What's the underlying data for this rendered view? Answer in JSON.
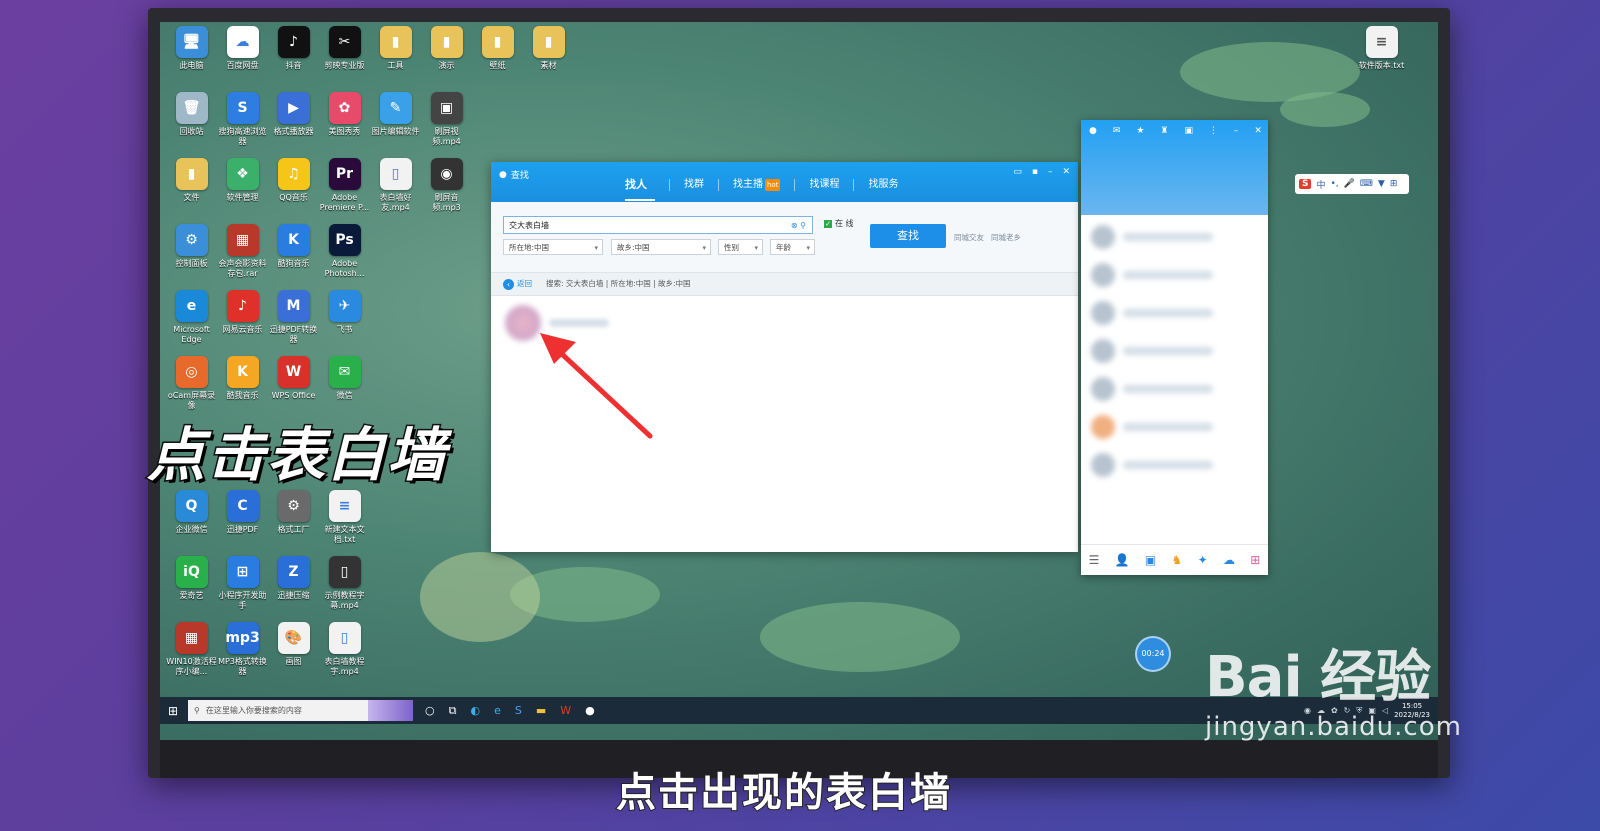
{
  "desktop": {
    "icons": [
      {
        "label": "此电脑",
        "color": "#3a8fd8",
        "glyph": "🖥"
      },
      {
        "label": "百度网盘",
        "color": "#ffffff",
        "glyph": "☁"
      },
      {
        "label": "抖音",
        "color": "#111111",
        "glyph": "♪"
      },
      {
        "label": "剪映专业版",
        "color": "#111111",
        "glyph": "✂"
      },
      {
        "label": "工具",
        "color": "#e8c35a",
        "glyph": "▮"
      },
      {
        "label": "演示",
        "color": "#e8c35a",
        "glyph": "▮"
      },
      {
        "label": "壁纸",
        "color": "#e8c35a",
        "glyph": "▮"
      },
      {
        "label": "素材",
        "color": "#e8c35a",
        "glyph": "▮"
      },
      {
        "label": "回收站",
        "color": "#9fb8c8",
        "glyph": "🗑"
      },
      {
        "label": "搜狗高速浏览器",
        "color": "#2e7de0",
        "glyph": "S"
      },
      {
        "label": "格式播放器",
        "color": "#3a6fd8",
        "glyph": "▶"
      },
      {
        "label": "美图秀秀",
        "color": "#e84a6a",
        "glyph": "✿"
      },
      {
        "label": "图片编辑软件",
        "color": "#3aa0e8",
        "glyph": "✎"
      },
      {
        "label": "刷屏视频.mp4",
        "color": "#444444",
        "glyph": "▣"
      },
      {
        "label": "",
        "color": "transparent",
        "glyph": ""
      },
      {
        "label": "",
        "color": "transparent",
        "glyph": ""
      },
      {
        "label": "文件",
        "color": "#e8c35a",
        "glyph": "▮"
      },
      {
        "label": "软件管理",
        "color": "#3ab06a",
        "glyph": "❖"
      },
      {
        "label": "QQ音乐",
        "color": "#f5c518",
        "glyph": "♫"
      },
      {
        "label": "Adobe Premiere P...",
        "color": "#2a0a3a",
        "glyph": "Pr"
      },
      {
        "label": "表白墙好友.mp4",
        "color": "#f2f2f2",
        "glyph": "▯"
      },
      {
        "label": "刷屏音频.mp3",
        "color": "#333333",
        "glyph": "◉"
      },
      {
        "label": "",
        "color": "transparent",
        "glyph": ""
      },
      {
        "label": "",
        "color": "transparent",
        "glyph": ""
      },
      {
        "label": "控制面板",
        "color": "#3a8fd8",
        "glyph": "⚙"
      },
      {
        "label": "会声会影资料存包.rar",
        "color": "#b8382a",
        "glyph": "▦"
      },
      {
        "label": "酷狗音乐",
        "color": "#2a7de0",
        "glyph": "K"
      },
      {
        "label": "Adobe Photosh...",
        "color": "#0a1a3a",
        "glyph": "Ps"
      },
      {
        "label": "",
        "color": "transparent",
        "glyph": ""
      },
      {
        "label": "",
        "color": "transparent",
        "glyph": ""
      },
      {
        "label": "",
        "color": "transparent",
        "glyph": ""
      },
      {
        "label": "",
        "color": "transparent",
        "glyph": ""
      },
      {
        "label": "Microsoft Edge",
        "color": "#1a8ad8",
        "glyph": "e"
      },
      {
        "label": "网易云音乐",
        "color": "#e0302a",
        "glyph": "♪"
      },
      {
        "label": "迅捷PDF转换器",
        "color": "#3a6fd8",
        "glyph": "M"
      },
      {
        "label": "飞书",
        "color": "#2a8ae0",
        "glyph": "✈"
      },
      {
        "label": "",
        "color": "transparent",
        "glyph": ""
      },
      {
        "label": "",
        "color": "transparent",
        "glyph": ""
      },
      {
        "label": "",
        "color": "transparent",
        "glyph": ""
      },
      {
        "label": "",
        "color": "transparent",
        "glyph": ""
      },
      {
        "label": "oCam屏幕录像",
        "color": "#e86a2a",
        "glyph": "◎"
      },
      {
        "label": "酷我音乐",
        "color": "#f5a623",
        "glyph": "K"
      },
      {
        "label": "WPS Office",
        "color": "#d8302a",
        "glyph": "W"
      },
      {
        "label": "微信",
        "color": "#2ab04a",
        "glyph": "✉"
      },
      {
        "label": "",
        "color": "transparent",
        "glyph": ""
      },
      {
        "label": "",
        "color": "transparent",
        "glyph": ""
      },
      {
        "label": "",
        "color": "transparent",
        "glyph": ""
      },
      {
        "label": "",
        "color": "transparent",
        "glyph": ""
      }
    ],
    "icons_lower": [
      {
        "label": "企业微信",
        "color": "#2a8ad8",
        "glyph": "Q"
      },
      {
        "label": "迅捷PDF",
        "color": "#2a6fd8",
        "glyph": "C"
      },
      {
        "label": "格式工厂",
        "color": "#6a6a6a",
        "glyph": "⚙"
      },
      {
        "label": "新建文本文档.txt",
        "color": "#f2f2f2",
        "glyph": "≡"
      },
      {
        "label": "爱奇艺",
        "color": "#2ab04a",
        "glyph": "iQ"
      },
      {
        "label": "小程序开发助手",
        "color": "#2a7de0",
        "glyph": "⊞"
      },
      {
        "label": "迅捷压缩",
        "color": "#2a6fd8",
        "glyph": "Z"
      },
      {
        "label": "示例教程字幕.mp4",
        "color": "#333333",
        "glyph": "▯"
      },
      {
        "label": "WIN10激活程序小编...",
        "color": "#b8382a",
        "glyph": "▦"
      },
      {
        "label": "MP3格式转换器",
        "color": "#2a6fd8",
        "glyph": "mp3"
      },
      {
        "label": "画图",
        "color": "#f2f2f2",
        "glyph": "🎨"
      },
      {
        "label": "表白墙教程字.mp4",
        "color": "#f2f2f2",
        "glyph": "▯"
      }
    ],
    "file_icon": {
      "label": "软件版本.txt",
      "color": "#f2f2f2",
      "glyph": "≡"
    }
  },
  "overlay_caption": "点击表白墙",
  "find_window": {
    "title": "查找",
    "tabs": [
      "找人",
      "找群",
      "找主播",
      "找课程",
      "找服务"
    ],
    "hot_badge": "hot",
    "keyword_value": "交大表白墙",
    "online_label": "在 线",
    "location_select": "所在地:中国",
    "hometown_select": "故乡:中国",
    "gender_select": "性别",
    "age_select": "年龄",
    "find_button": "查找",
    "same_city_link": "同城交友",
    "same_town_link": "同城老乡",
    "back_label": "返回",
    "search_summary": "搜索: 交大表白墙 | 所在地:中国 | 故乡:中国"
  },
  "qq_panel": {
    "footer_icons": [
      "menu-icon",
      "contacts-icon",
      "file-icon",
      "game-icon",
      "controller-icon",
      "cloud-icon",
      "apps-icon"
    ]
  },
  "ime_bar": {
    "logo": "S",
    "mode": "中"
  },
  "timer": "00:24",
  "taskbar": {
    "search_placeholder": "在这里输入你要搜索的内容",
    "clock_time": "15:05",
    "clock_date": "2022/8/23"
  },
  "subtitle": "点击出现的表白墙",
  "watermark": {
    "brand": "Bai 经验",
    "url": "jingyan.baidu.com"
  }
}
